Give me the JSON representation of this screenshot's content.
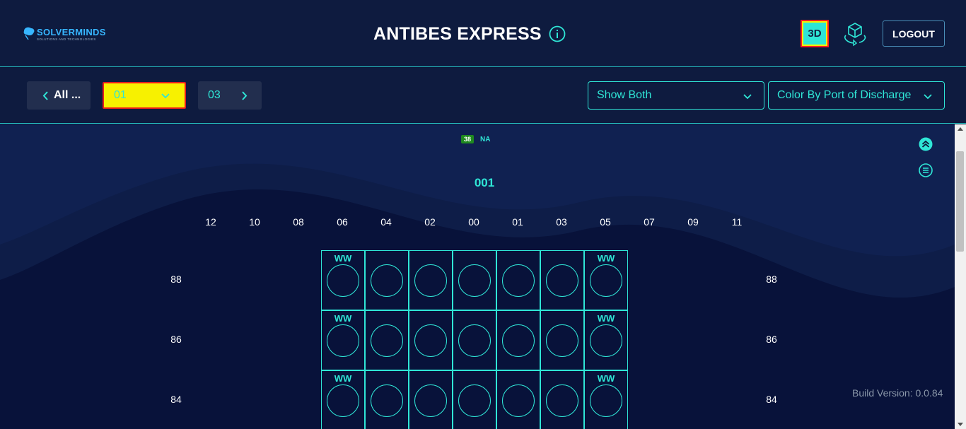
{
  "header": {
    "logo": {
      "brand": "SOLVERMINDS",
      "tagline": "SOLUTIONS AND TECHNOLOGIES"
    },
    "title": "ANTIBES EXPRESS",
    "info_icon": "info-icon",
    "view_3d_label": "3D",
    "cube_icon": "cube-rotate-icon",
    "logout_label": "LOGOUT"
  },
  "toolbar": {
    "prev_label": "All ...",
    "bay_select_value": "01",
    "next_label": "03",
    "show_filter": "Show Both",
    "color_by": "Color By Port of Discharge"
  },
  "legend": [
    {
      "count": "38",
      "label": "NA",
      "color": "#1f8a1f"
    }
  ],
  "bay": {
    "number": "001",
    "columns": [
      "12",
      "10",
      "08",
      "06",
      "04",
      "02",
      "00",
      "01",
      "03",
      "05",
      "07",
      "09",
      "11"
    ],
    "tiers": [
      "88",
      "86",
      "84"
    ],
    "cell_columns": [
      "06",
      "04",
      "02",
      "00",
      "01",
      "03",
      "05"
    ],
    "ww_label": "WW",
    "ww_columns": [
      "06",
      "05"
    ]
  },
  "side_icons": [
    "expand-up-icon",
    "list-menu-icon"
  ],
  "footer": {
    "build_version": "Build Version: 0.0.84"
  },
  "colors": {
    "accent": "#2fe6d6",
    "highlight": "#f7f100",
    "highlight_border": "#e81d1d",
    "background": "#0b1638"
  }
}
